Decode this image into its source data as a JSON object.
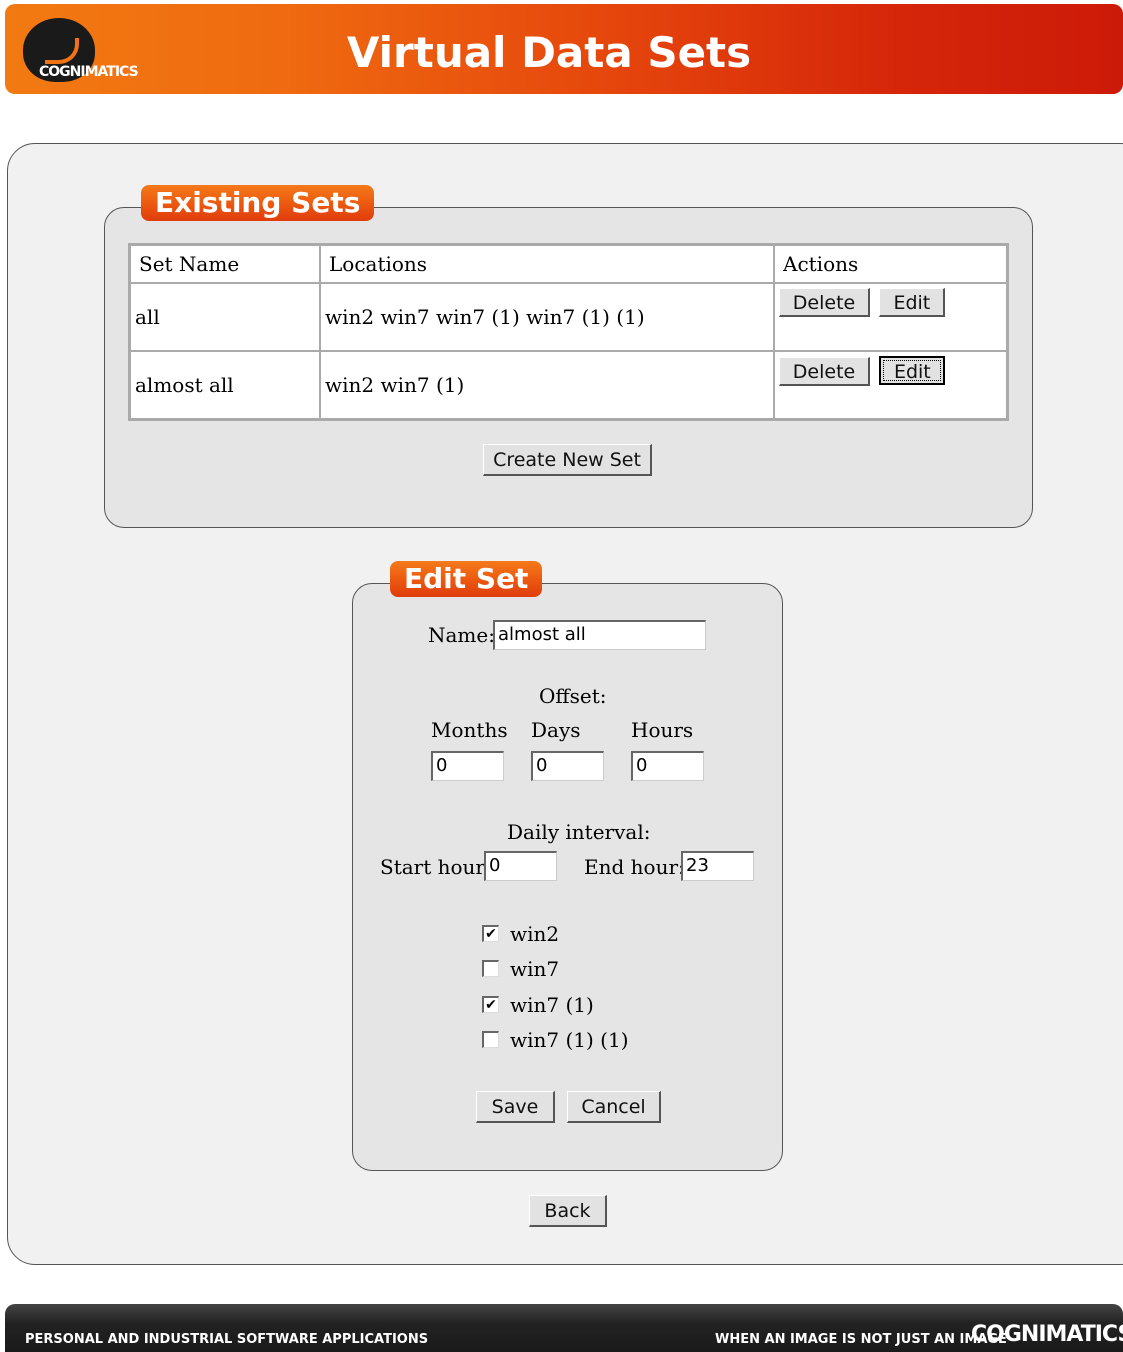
{
  "header": {
    "title": "Virtual Data Sets",
    "logo_text": "COGNIMATICS"
  },
  "existing": {
    "legend": "Existing Sets",
    "columns": [
      "Set Name",
      "Locations",
      "Actions"
    ],
    "rows": [
      {
        "name": "all",
        "locations": "win2 win7 win7 (1) win7 (1) (1)",
        "delete": "Delete",
        "edit": "Edit"
      },
      {
        "name": "almost all",
        "locations": "win2 win7 (1)",
        "delete": "Delete",
        "edit": "Edit"
      }
    ],
    "create_button": "Create New Set"
  },
  "edit": {
    "legend": "Edit Set",
    "name_label": "Name:",
    "name_value": "almost all",
    "offset_label": "Offset:",
    "months_label": "Months",
    "days_label": "Days",
    "hours_label": "Hours",
    "months_value": "0",
    "days_value": "0",
    "hours_value": "0",
    "interval_label": "Daily interval:",
    "start_label": "Start hour:",
    "start_value": "0",
    "end_label": "End hour:",
    "end_value": "23",
    "locations": [
      {
        "label": "win2",
        "checked": true
      },
      {
        "label": "win7",
        "checked": false
      },
      {
        "label": "win7 (1)",
        "checked": true
      },
      {
        "label": "win7 (1) (1)",
        "checked": false
      }
    ],
    "save_button": "Save",
    "cancel_button": "Cancel"
  },
  "back_button": "Back",
  "footer": {
    "left": "PERSONAL AND INDUSTRIAL SOFTWARE APPLICATIONS",
    "right": "WHEN AN IMAGE IS NOT JUST AN IMAGE",
    "brand": "COGNIMATICS"
  }
}
